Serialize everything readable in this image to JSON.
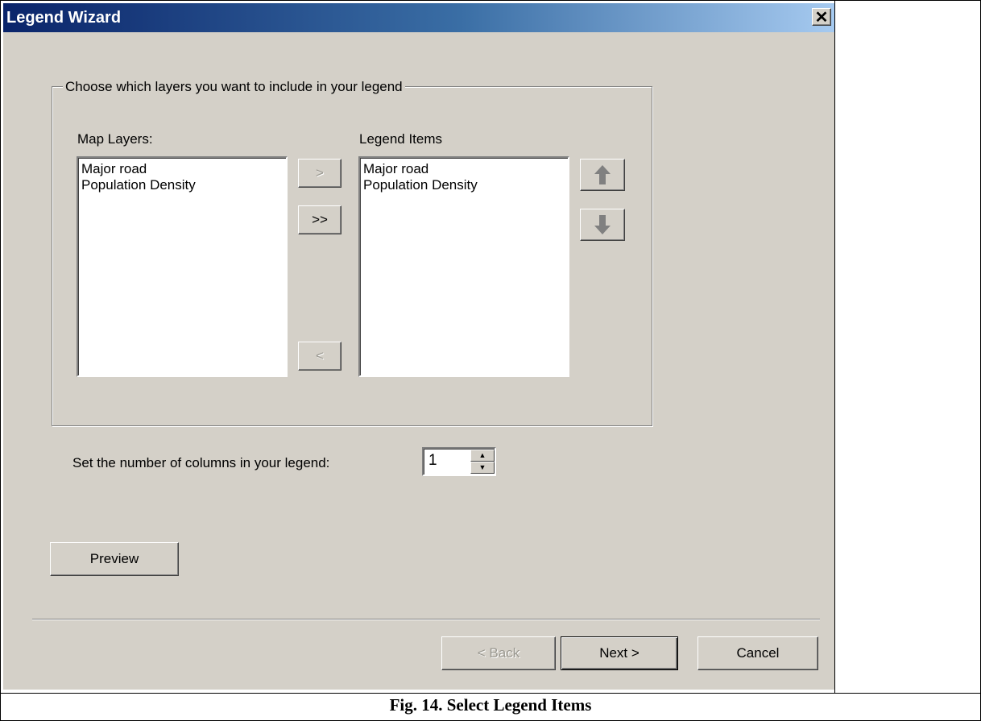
{
  "dialog": {
    "title": "Legend Wizard",
    "close_symbol": "✕",
    "group_label": "Choose which layers you want to include in your legend",
    "map_layers_label": "Map Layers:",
    "legend_items_label": "Legend Items",
    "map_layers": [
      "Major road",
      "Population Density"
    ],
    "legend_items": [
      "Major road",
      "Population Density"
    ],
    "buttons": {
      "add_one": ">",
      "add_all": ">>",
      "remove_one": "<",
      "preview": "Preview",
      "back": "< Back",
      "next": "Next >",
      "cancel": "Cancel"
    },
    "columns_label": "Set the number of columns in your legend:",
    "columns_value": "1",
    "icons": {
      "move_up": "arrow-up-icon",
      "move_down": "arrow-down-icon"
    }
  },
  "caption": "Fig. 14. Select Legend Items",
  "colors": {
    "titlebar_start": "#0a246a",
    "titlebar_end": "#a6caf0",
    "dialog_bg": "#d4d0c8"
  }
}
